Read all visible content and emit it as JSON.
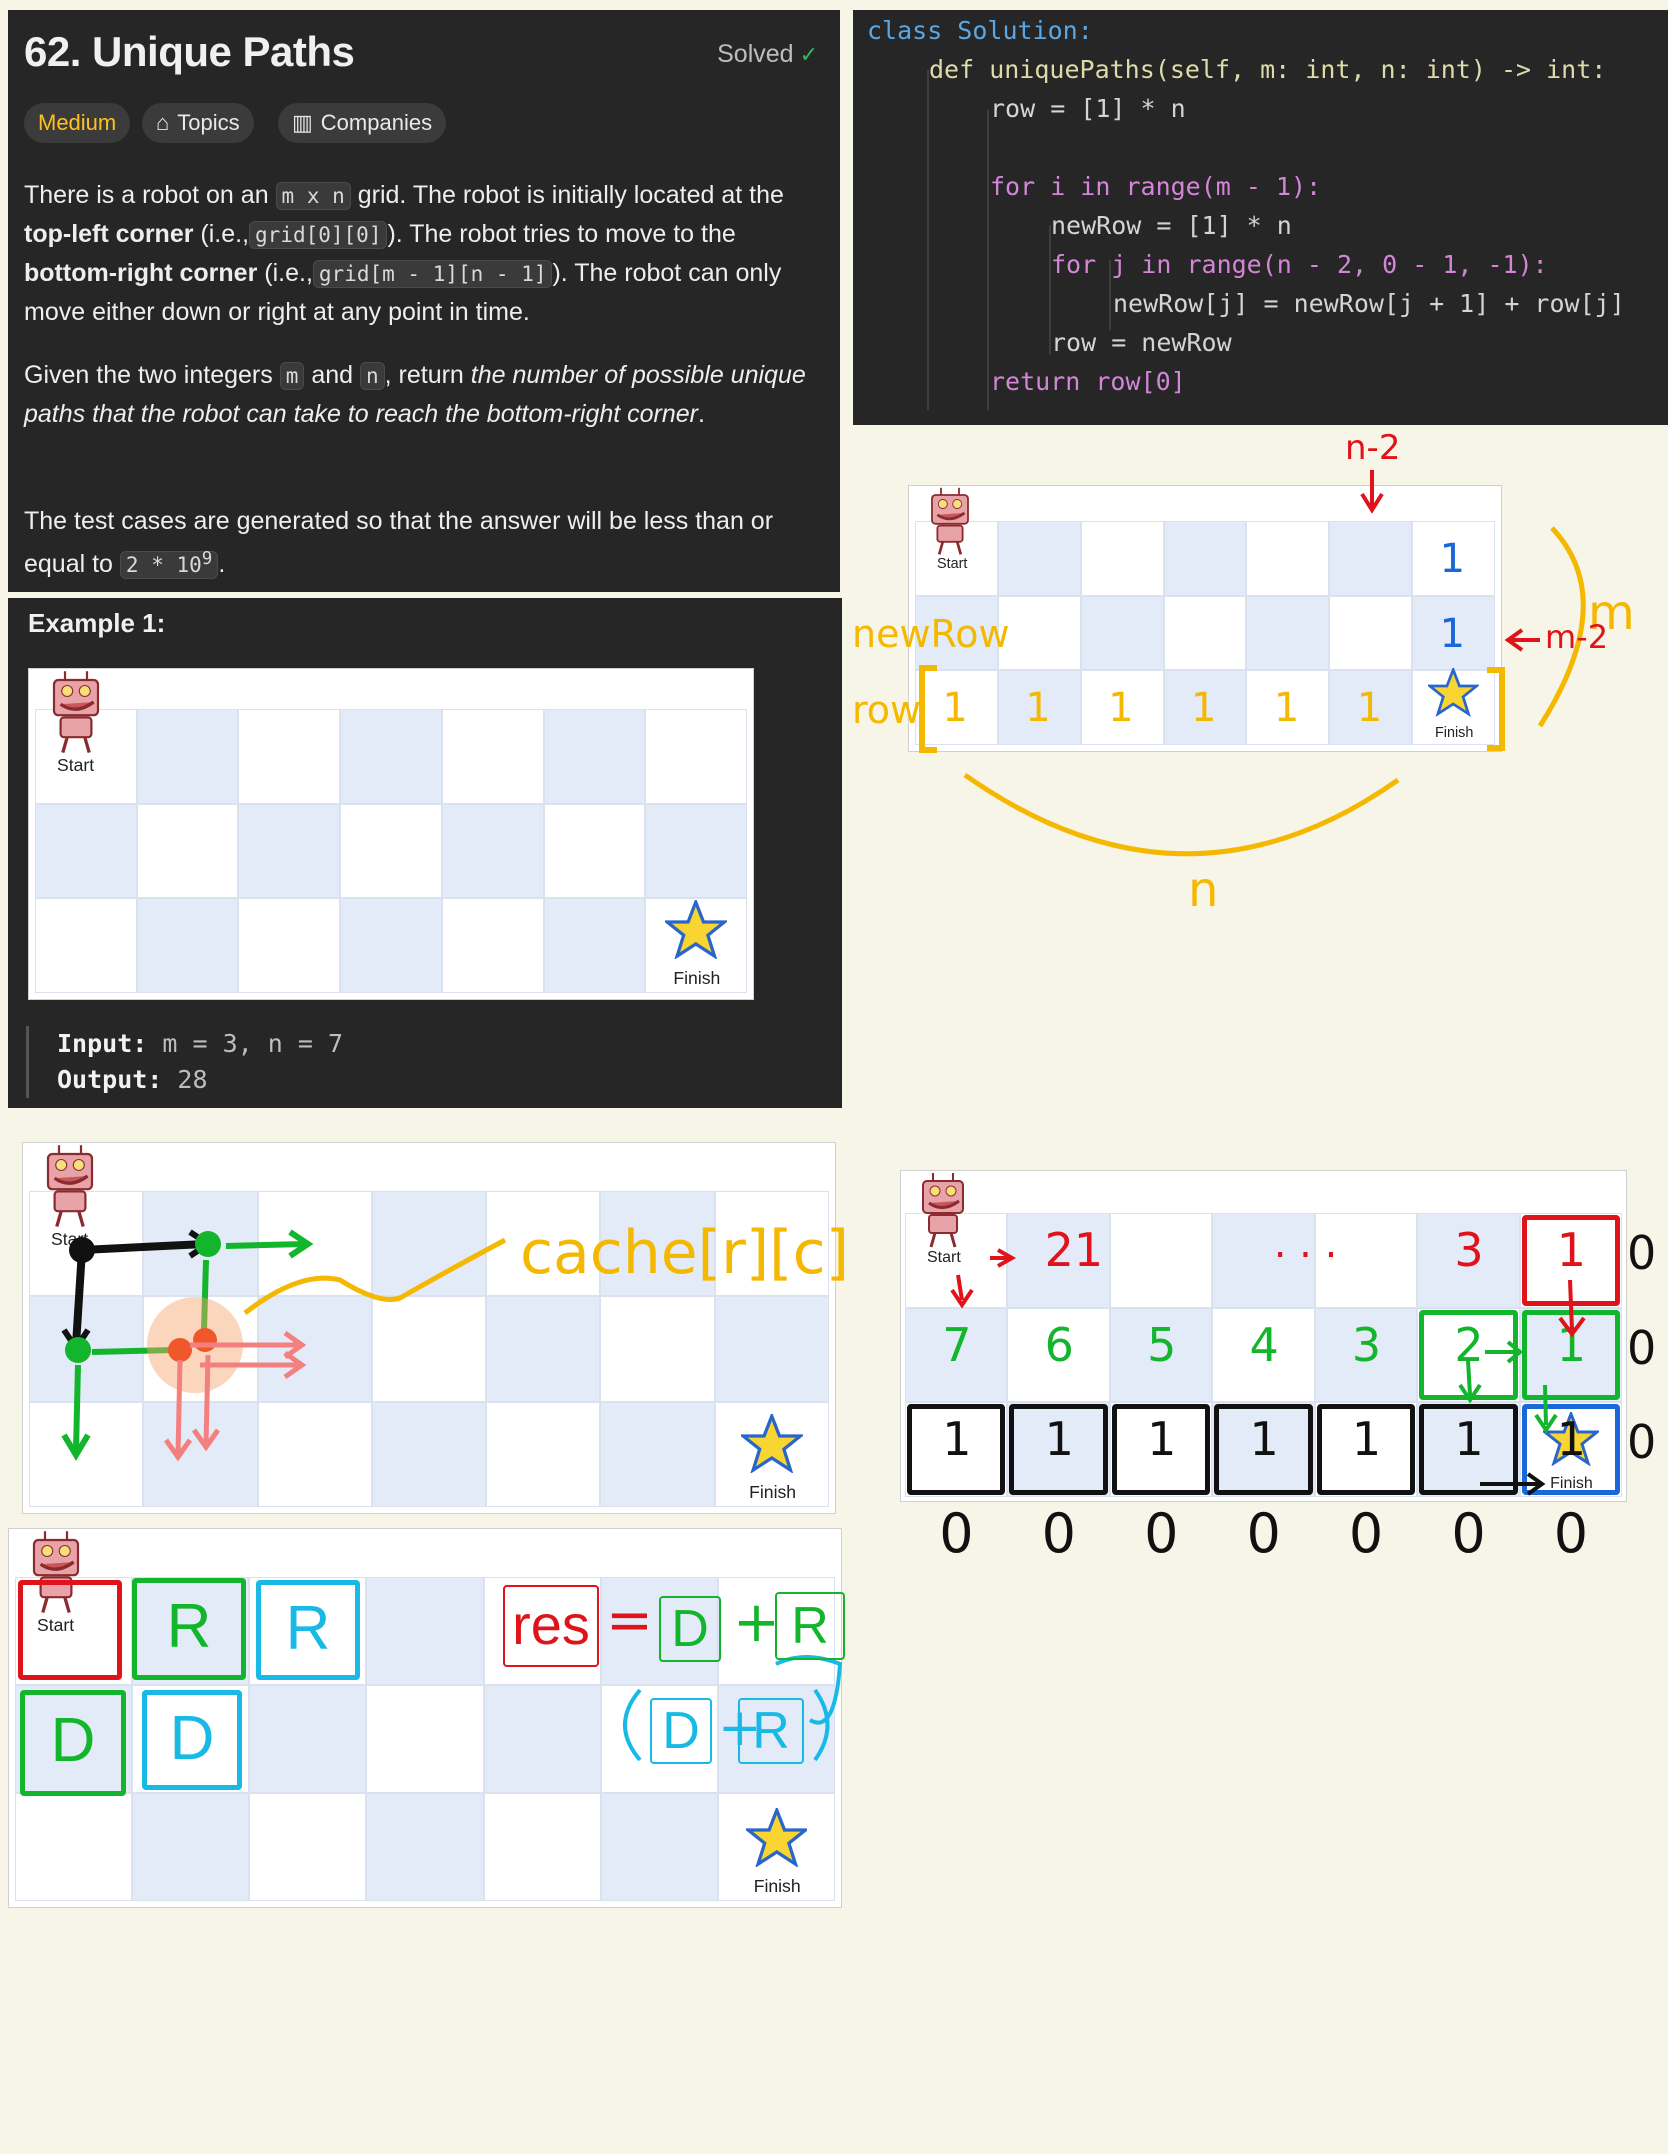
{
  "problem": {
    "title": "62. Unique Paths",
    "status": "Solved",
    "tags": [
      "Medium",
      "Topics",
      "Companies"
    ],
    "desc1_a": "There is a robot on an",
    "desc1_code1": "m x n",
    "desc1_b": "grid. The robot is initially located at the",
    "desc1_bold1": "top-left corner",
    "desc1_c": "(i.e.,",
    "desc1_code2": "grid[0][0]",
    "desc1_d": "). The robot tries to move to the",
    "desc1_bold2": "bottom-right corner",
    "desc1_e": "(i.e.,",
    "desc1_code3": "grid[m - 1][n - 1]",
    "desc1_f": "). The robot can only move either down or right at any point in time.",
    "desc2_a": "Given the two integers",
    "desc2_m": "m",
    "desc2_and": "and",
    "desc2_n": "n",
    "desc2_b": ", return",
    "desc2_italic": "the number of possible unique paths that the robot can take to reach the bottom-right corner",
    "desc2_end": ".",
    "desc3_a": "The test cases are generated so that the answer will be less than or equal to",
    "desc3_code": "2 * 10",
    "desc3_sup": "9",
    "desc3_end": "."
  },
  "example": {
    "title": "Example 1:",
    "start_label": "Start",
    "finish_label": "Finish",
    "input_label": "Input:",
    "input_value": "m = 3, n = 7",
    "output_label": "Output:",
    "output_value": "28"
  },
  "code": {
    "lines": [
      "class Solution:",
      "def uniquePaths(self, m: int, n: int) -> int:",
      "row = [1] * n",
      "for i in range(m - 1):",
      "newRow = [1] * n",
      "for j in range(n - 2, 0 - 1, -1):",
      "newRow[j] = newRow[j + 1] + row[j]",
      "row = newRow",
      "return row[0]"
    ]
  },
  "notes": {
    "n_minus_2": "n-2",
    "new_row": "newRow",
    "row": "row",
    "m": "m",
    "m_minus_2": "m-2",
    "n": "n",
    "cache": "cache[r][c]",
    "res": "res",
    "eq": "=",
    "plus": "+",
    "D": "D",
    "R": "R",
    "dots": ". . .",
    "table_top": [
      "21",
      "3",
      "1"
    ],
    "table_mid": [
      "7",
      "6",
      "5",
      "4",
      "3",
      "2",
      "1"
    ],
    "table_bottom": [
      "1",
      "1",
      "1",
      "1",
      "1",
      "1",
      "1"
    ],
    "zeros_right": [
      "0",
      "0",
      "0"
    ],
    "zeros_bottom": [
      "0",
      "0",
      "0",
      "0",
      "0",
      "0",
      "0"
    ]
  },
  "colors": {
    "yellow": "#f5b800",
    "red": "#e0131b",
    "green": "#12b52b",
    "cyan": "#19b9e6",
    "blue": "#1a67d8",
    "grid_blue": "#e3eaf8"
  }
}
